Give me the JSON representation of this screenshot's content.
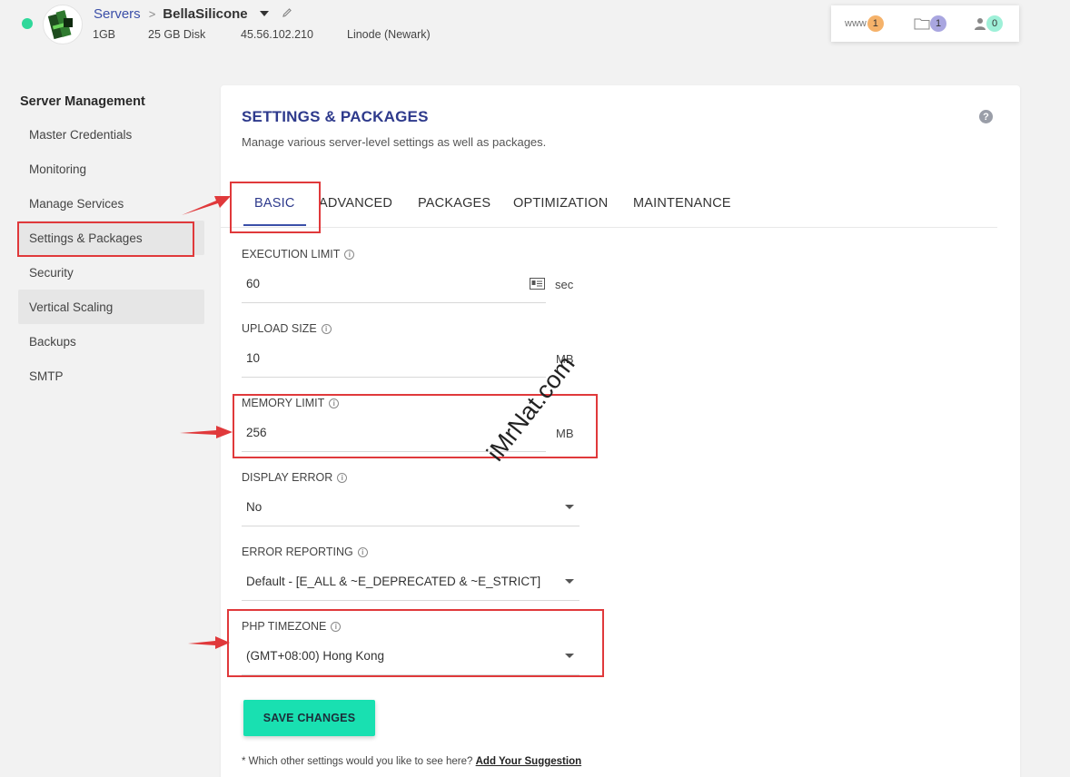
{
  "header": {
    "breadcrumb_root": "Servers",
    "breadcrumb_separator": ">",
    "server_name": "BellaSilicone",
    "meta": {
      "ram": "1GB",
      "disk": "25 GB Disk",
      "ip": "45.56.102.210",
      "provider": "Linode (Newark)"
    },
    "stats": {
      "www_label": "www",
      "www_count": "1",
      "files_count": "1",
      "users_count": "0"
    },
    "status_color": "#2fd89a"
  },
  "sidebar": {
    "title": "Server Management",
    "items": [
      {
        "label": "Master Credentials"
      },
      {
        "label": "Monitoring"
      },
      {
        "label": "Manage Services"
      },
      {
        "label": "Settings & Packages",
        "active": true
      },
      {
        "label": "Security"
      },
      {
        "label": "Vertical Scaling"
      },
      {
        "label": "Backups"
      },
      {
        "label": "SMTP"
      }
    ]
  },
  "main": {
    "title": "SETTINGS & PACKAGES",
    "subtitle": "Manage various server-level settings as well as packages.",
    "help_icon": "?",
    "tabs": [
      {
        "label": "BASIC",
        "active": true
      },
      {
        "label": "ADVANCED"
      },
      {
        "label": "PACKAGES"
      },
      {
        "label": "OPTIMIZATION"
      },
      {
        "label": "MAINTENANCE"
      }
    ],
    "fields": {
      "execution_limit": {
        "label": "EXECUTION LIMIT",
        "value": "60",
        "unit": "sec"
      },
      "upload_size": {
        "label": "UPLOAD SIZE",
        "value": "10",
        "unit": "MB"
      },
      "memory_limit": {
        "label": "MEMORY LIMIT",
        "value": "256",
        "unit": "MB"
      },
      "display_error": {
        "label": "DISPLAY ERROR",
        "value": "No"
      },
      "error_reporting": {
        "label": "ERROR REPORTING",
        "value": "Default - [E_ALL & ~E_DEPRECATED & ~E_STRICT]"
      },
      "php_timezone": {
        "label": "PHP TIMEZONE",
        "value": "(GMT+08:00) Hong Kong"
      }
    },
    "save_label": "SAVE CHANGES",
    "footnote_text": "* Which other settings would you like to see here?",
    "footnote_link": "Add Your Suggestion"
  },
  "watermark": "iMrNat.com",
  "colors": {
    "accent": "#2e3a8c",
    "save_button": "#19e0b1",
    "annotation_red": "#e0393b"
  }
}
